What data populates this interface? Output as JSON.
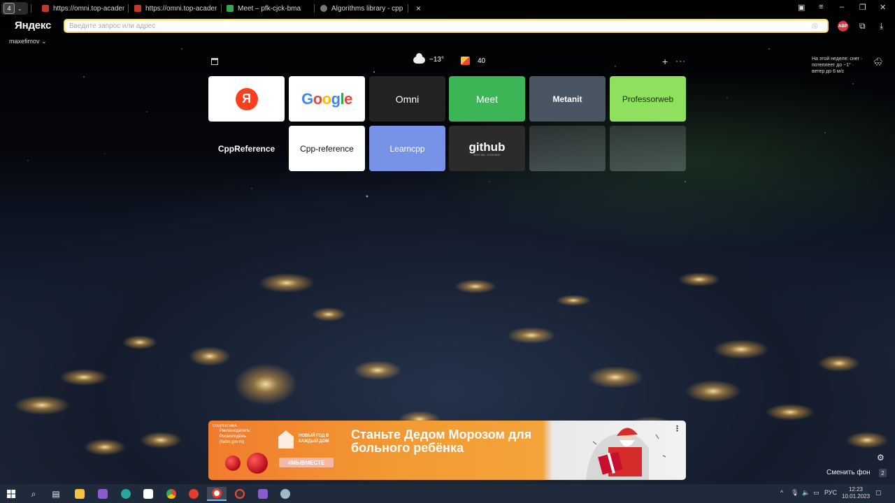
{
  "browser": {
    "tab_count": "4",
    "tabs": [
      {
        "title": "https://omni.top-academy",
        "color": "#c0392b"
      },
      {
        "title": "https://omni.top-academy",
        "color": "#c0392b"
      },
      {
        "title": "Meet – pfk-cjck-bma",
        "color": "#34a853"
      },
      {
        "title": "Algorithms library - cppref",
        "color": "#777777"
      }
    ],
    "close_tab": "×",
    "logo": "Яндекс",
    "search_placeholder": "Введите запрос или адрес",
    "abp_label": "ABP",
    "account": "maxefimov"
  },
  "newtab": {
    "weather_temp": "−13°",
    "mail_count": "40",
    "weekly_forecast": "На этой неделе: снег · потеплеет до −1° · ветер до 6 м/с",
    "tiles": [
      {
        "label": "Я",
        "kind": "yandex"
      },
      {
        "label": "Google",
        "kind": "google"
      },
      {
        "label": "Omni",
        "kind": "text"
      },
      {
        "label": "Meet",
        "kind": "text"
      },
      {
        "label": "Metanit",
        "kind": "text"
      },
      {
        "label": "Professorweb",
        "kind": "text"
      },
      {
        "label": "CppReference",
        "kind": "text"
      },
      {
        "label": "Cpp-reference",
        "kind": "text"
      },
      {
        "label": "Learncpp",
        "kind": "text"
      },
      {
        "label": "github",
        "sub": "SOCIAL CODING",
        "kind": "github"
      },
      {
        "label": "",
        "kind": "empty"
      },
      {
        "label": "",
        "kind": "empty"
      }
    ],
    "banner": {
      "ad_tag": "СОЦРЕКЛАМА",
      "advertiser": "Рекламодатель: Росмолодёжь (fadm.gov.ru)",
      "house_text": "НОВЫЙ ГОД В КАЖДЫЙ ДОМ",
      "hashtag": "#МЫВМЕСТЕ",
      "headline": "Станьте Дедом Морозом для больного ребёнка",
      "menu": "⋮"
    },
    "change_background": "Сменить фон",
    "background_count": "2"
  },
  "taskbar": {
    "language": "РУС",
    "time": "12:23",
    "date": "10.01.2023"
  }
}
